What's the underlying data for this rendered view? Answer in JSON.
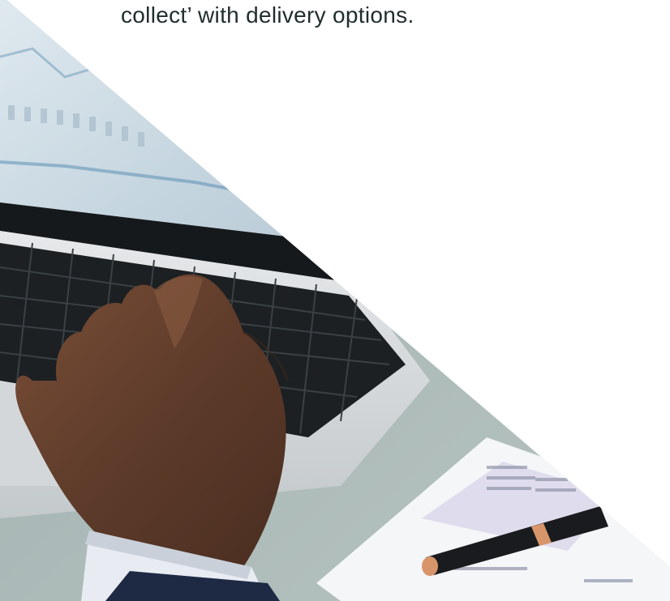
{
  "caption": {
    "text": "collect’ with delivery options."
  },
  "photo": {
    "subject": "hand-typing-on-laptop",
    "colors": {
      "screen": "#cfdde6",
      "desk": "#a7b5b3",
      "keyboard": "#1c2022",
      "skin": "#6b4531",
      "sleeve": "#1e2a44",
      "cuff": "#e8ecf2",
      "pen": "#1a1b1e",
      "pen_band": "#d8956a"
    }
  }
}
